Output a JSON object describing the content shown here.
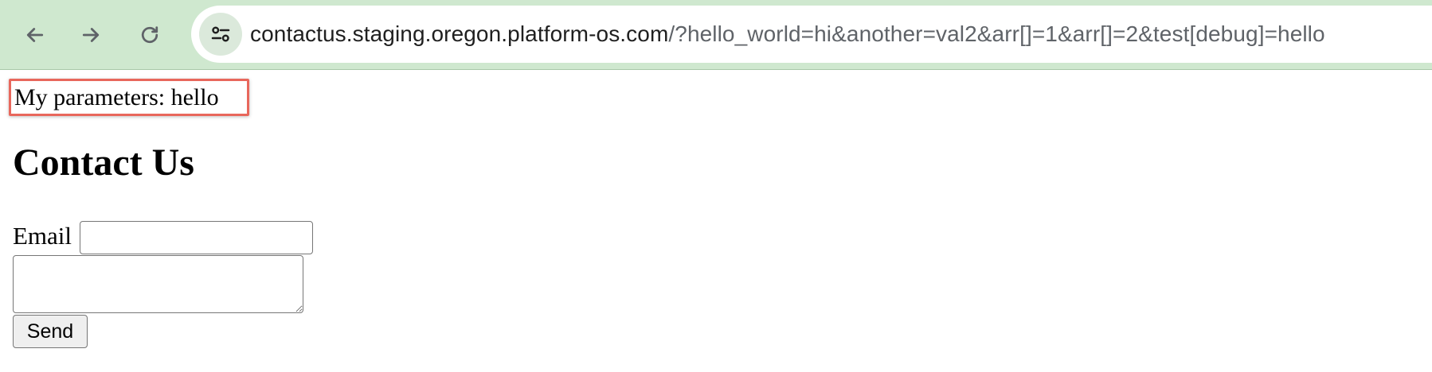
{
  "browser": {
    "url_host": "contactus.staging.oregon.platform-os.com",
    "url_rest": "/?hello_world=hi&another=val2&arr[]=1&arr[]=2&test[debug]=hello",
    "back_icon": "arrow-left-icon",
    "forward_icon": "arrow-right-icon",
    "reload_icon": "reload-icon",
    "site_info_icon": "tune-icon",
    "toolbar_color": "#cfe8cf"
  },
  "page": {
    "parameters_text": "My parameters: hello",
    "highlight_color": "#e8675c",
    "title": "Contact Us",
    "form": {
      "email_label": "Email",
      "email_value": "",
      "message_value": "",
      "send_label": "Send"
    }
  }
}
